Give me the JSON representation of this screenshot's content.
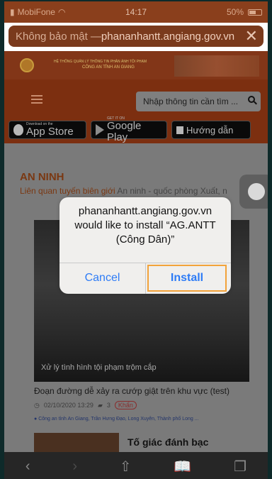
{
  "status_bar": {
    "carrier": "MobiFone",
    "time": "14:17",
    "battery": "50%"
  },
  "url_bar": {
    "prefix": "Không bảo mật — ",
    "domain": "phananhantt.angiang.gov.vn",
    "close": "✕"
  },
  "banner": {
    "line1": "HỆ THỐNG QUẢN LÝ THÔNG TIN PHẢN ÁNH TỘI PHẠM",
    "line2": "CÔNG AN TỈNH AN GIANG"
  },
  "header": {
    "search_placeholder": "Nhập thông tin cần tìm ...",
    "app_store": {
      "small": "Download on the",
      "big": "App Store"
    },
    "google_play": {
      "small": "GET IT ON",
      "big": "Google Play"
    },
    "guide": "Hướng dẫn"
  },
  "section": {
    "title": "AN NINH",
    "subnav_active": "Liên quan tuyến biên giới",
    "subnav_rest": "An ninh - quốc phòng   Xuất, n"
  },
  "article": {
    "photo_caption": "Xử lý tình hình tội phạm trộm cắp",
    "headline": "Đoạn đường dễ xảy ra cướp giật trên khu vực (test)",
    "date": "02/10/2020 13:29",
    "comments": "3",
    "badge": "Khẩn",
    "location": "Công an tỉnh An Giang, Trần Hưng Đạo, Long Xuyên, Thành phố Long ...",
    "next_title": "Tố giác đánh bạc"
  },
  "dialog": {
    "message_line1": "phananhantt.angiang.gov.vn",
    "message_line2": "would like to install “AG.ANTT",
    "message_line3": "(Công Dân)”",
    "cancel": "Cancel",
    "install": "Install"
  },
  "toolbar": {
    "back": "‹",
    "forward": "›",
    "share": "⇧",
    "bookmarks": "📖",
    "tabs": "❐"
  },
  "colors": {
    "accent": "#2e7cf6",
    "focus_ring": "#f2a33a",
    "brand": "#e06424"
  }
}
